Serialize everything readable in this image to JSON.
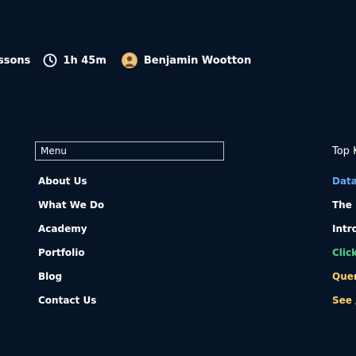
{
  "hero": {
    "heading": "··· ······ ·····"
  },
  "meta": {
    "lessons": "ssons",
    "duration": "1h 45m",
    "author": "Benjamin Wootton"
  },
  "menu": {
    "label": "Menu",
    "items": [
      {
        "label": "About Us"
      },
      {
        "label": "What We Do"
      },
      {
        "label": "Academy"
      },
      {
        "label": "Portfolio"
      },
      {
        "label": "Blog"
      },
      {
        "label": "Contact Us"
      }
    ]
  },
  "right_panel": {
    "items": [
      {
        "label": "Top K"
      },
      {
        "label": "Data"
      },
      {
        "label": "The I"
      },
      {
        "label": "Intro"
      },
      {
        "label": "Click"
      },
      {
        "label": "Quer"
      },
      {
        "label": "See /"
      }
    ]
  },
  "colors": {
    "background": "#071428",
    "text": "#ffffff",
    "menu_border": "#c4c8cf",
    "data_tag": "#6aa9f0",
    "click_tag": "#53d28a",
    "query_tag": "#ffd166"
  },
  "icons": {
    "clock": "clock-icon",
    "avatar": "author-avatar"
  }
}
